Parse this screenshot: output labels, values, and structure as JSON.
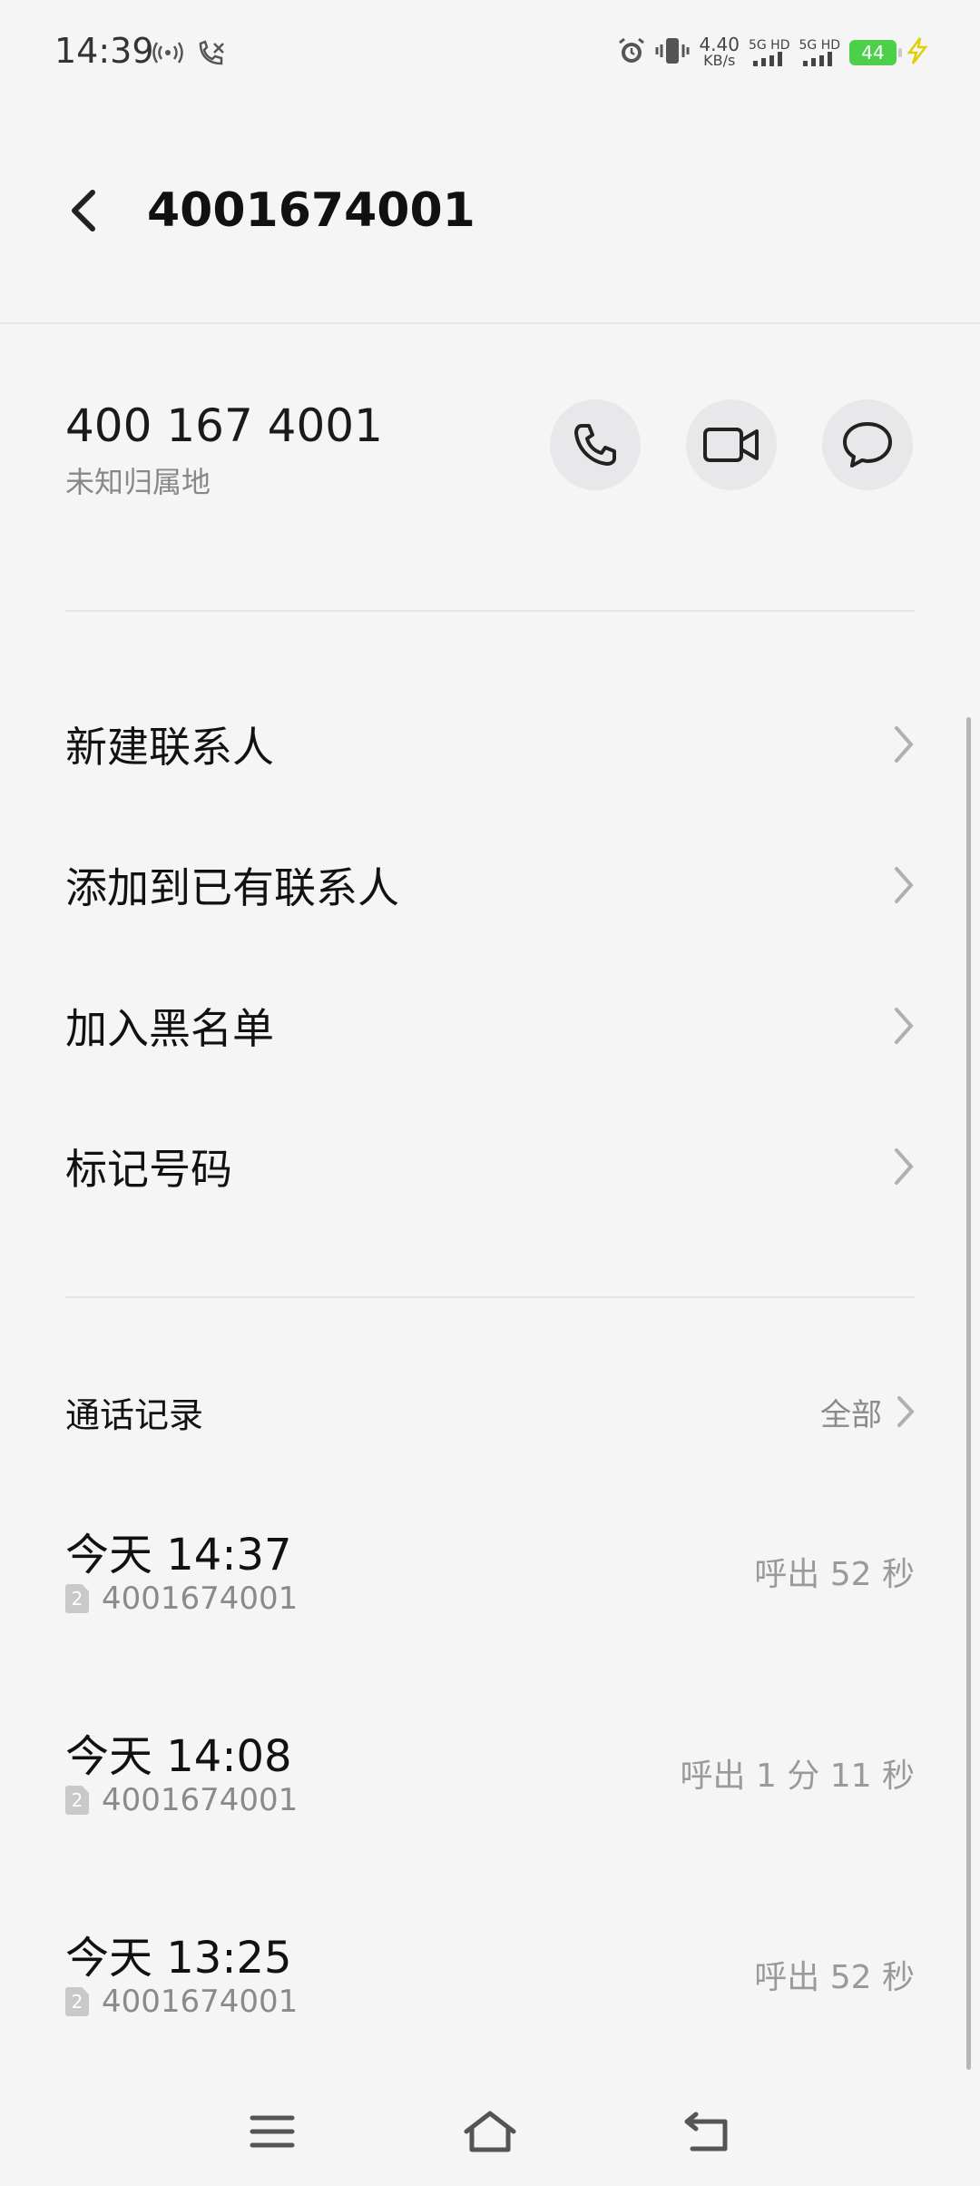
{
  "status_bar": {
    "time": "14:39",
    "speed_value": "4.40",
    "speed_unit": "KB/s",
    "network_1": "5G HD",
    "network_2": "5G HD",
    "battery": "44"
  },
  "header": {
    "title": "4001674001"
  },
  "number_info": {
    "formatted_number": "400 167 4001",
    "location": "未知归属地"
  },
  "options": [
    {
      "label": "新建联系人"
    },
    {
      "label": "添加到已有联系人"
    },
    {
      "label": "加入黑名单"
    },
    {
      "label": "标记号码"
    }
  ],
  "call_log": {
    "title": "通话记录",
    "all_label": "全部",
    "entries": [
      {
        "time": "今天 14:37",
        "sim": "2",
        "number": "4001674001",
        "duration": "呼出 52 秒"
      },
      {
        "time": "今天 14:08",
        "sim": "2",
        "number": "4001674001",
        "duration": "呼出 1 分 11 秒"
      },
      {
        "time": "今天 13:25",
        "sim": "2",
        "number": "4001674001",
        "duration": "呼出 52 秒"
      }
    ]
  },
  "colors": {
    "background": "#f5f5f6",
    "battery": "#4ccf4a",
    "charging": "#e0d000"
  }
}
